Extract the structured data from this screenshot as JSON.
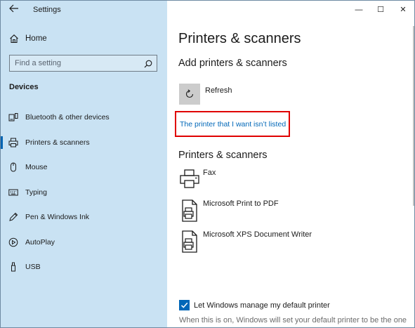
{
  "window": {
    "title": "Settings",
    "controls": {
      "minimize": "—",
      "maximize": "☐",
      "close": "✕"
    }
  },
  "sidebar": {
    "back_icon": "back-arrow-icon",
    "home_label": "Home",
    "search_placeholder": "Find a setting",
    "section_title": "Devices",
    "items": [
      {
        "label": "Bluetooth & other devices",
        "icon": "bluetooth-icon",
        "active": false
      },
      {
        "label": "Printers & scanners",
        "icon": "printer-icon",
        "active": true
      },
      {
        "label": "Mouse",
        "icon": "mouse-icon",
        "active": false
      },
      {
        "label": "Typing",
        "icon": "keyboard-icon",
        "active": false
      },
      {
        "label": "Pen & Windows Ink",
        "icon": "pen-icon",
        "active": false
      },
      {
        "label": "AutoPlay",
        "icon": "autoplay-icon",
        "active": false
      },
      {
        "label": "USB",
        "icon": "usb-icon",
        "active": false
      }
    ]
  },
  "main": {
    "page_title": "Printers & scanners",
    "add_heading": "Add printers & scanners",
    "refresh_label": "Refresh",
    "not_listed_link": "The printer that I want isn’t listed",
    "printers_heading": "Printers & scanners",
    "printers": [
      {
        "name": "Fax",
        "icon": "fax-printer-icon"
      },
      {
        "name": "Microsoft Print to PDF",
        "icon": "printer-document-icon"
      },
      {
        "name": "Microsoft XPS Document Writer",
        "icon": "printer-document-icon"
      }
    ],
    "default_printer_checkbox": {
      "label": "Let Windows manage my default printer",
      "checked": true
    },
    "default_printer_description": "When this is on, Windows will set your default printer to be the one"
  },
  "colors": {
    "sidebar_bg": "#c9e2f3",
    "accent": "#0067b8",
    "highlight_box": "#e00000"
  }
}
